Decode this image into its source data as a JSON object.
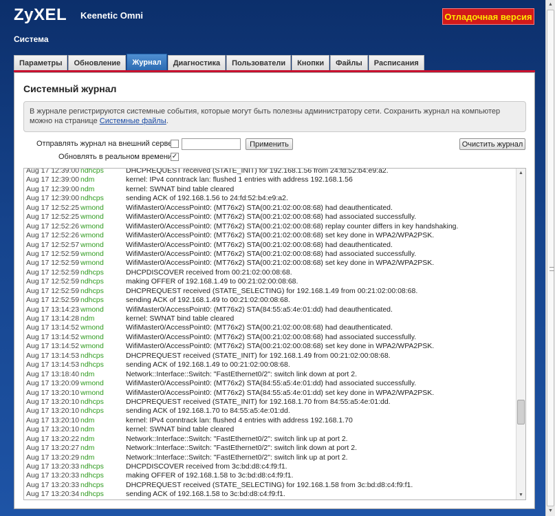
{
  "header": {
    "logo": "ZyXEL",
    "product": "Keenetic Omni",
    "debug_badge": "Отладочная версия",
    "section": "Система"
  },
  "tabs": [
    {
      "label": "Параметры",
      "active": false
    },
    {
      "label": "Обновление",
      "active": false
    },
    {
      "label": "Журнал",
      "active": true
    },
    {
      "label": "Диагностика",
      "active": false
    },
    {
      "label": "Пользователи",
      "active": false
    },
    {
      "label": "Кнопки",
      "active": false
    },
    {
      "label": "Файлы",
      "active": false
    },
    {
      "label": "Расписания",
      "active": false
    }
  ],
  "panel": {
    "title": "Системный журнал",
    "info_text": "В журнале регистрируются системные события, которые могут быть полезны администратору сети. Сохранить журнал на компьютер можно на странице ",
    "info_link": "Системные файлы",
    "info_suffix": "."
  },
  "controls": {
    "external_server_label": "Отправлять журнал на внешний сервер:",
    "external_server_checked": false,
    "server_value": "",
    "apply_button": "Применить",
    "clear_button": "Очистить журнал",
    "realtime_label": "Обновлять в реальном времени:",
    "realtime_checked": true,
    "checkmark": "✓"
  },
  "icons": {
    "scroll_up": "▲",
    "scroll_down": "▼"
  },
  "colors": {
    "service": "#2e9a1e",
    "active_tab": "#2c6bb2",
    "badge_bg": "#d21a1a",
    "badge_text": "#ffe600"
  },
  "log": [
    {
      "ts": "Aug 17 12:39:00",
      "svc": "ndhcps",
      "msg": "DHCPREQUEST received (STATE_INIT) for 192.168.1.56 from 24:fd:52:b4:e9:a2."
    },
    {
      "ts": "Aug 17 12:39:00",
      "svc": "ndm",
      "msg": "kernel: IPv4 conntrack lan: flushed 1 entries with address 192.168.1.56"
    },
    {
      "ts": "Aug 17 12:39:00",
      "svc": "ndm",
      "msg": "kernel: SWNAT bind table cleared"
    },
    {
      "ts": "Aug 17 12:39:00",
      "svc": "ndhcps",
      "msg": "sending ACK of 192.168.1.56 to 24:fd:52:b4:e9:a2."
    },
    {
      "ts": "Aug 17 12:52:25",
      "svc": "wmond",
      "msg": "WifiMaster0/AccessPoint0: (MT76x2) STA(00:21:02:00:08:68) had deauthenticated."
    },
    {
      "ts": "Aug 17 12:52:25",
      "svc": "wmond",
      "msg": "WifiMaster0/AccessPoint0: (MT76x2) STA(00:21:02:00:08:68) had associated successfully."
    },
    {
      "ts": "Aug 17 12:52:26",
      "svc": "wmond",
      "msg": "WifiMaster0/AccessPoint0: (MT76x2) STA(00:21:02:00:08:68) replay counter differs in key handshaking."
    },
    {
      "ts": "Aug 17 12:52:26",
      "svc": "wmond",
      "msg": "WifiMaster0/AccessPoint0: (MT76x2) STA(00:21:02:00:08:68) set key done in WPA2/WPA2PSK."
    },
    {
      "ts": "Aug 17 12:52:57",
      "svc": "wmond",
      "msg": "WifiMaster0/AccessPoint0: (MT76x2) STA(00:21:02:00:08:68) had deauthenticated."
    },
    {
      "ts": "Aug 17 12:52:59",
      "svc": "wmond",
      "msg": "WifiMaster0/AccessPoint0: (MT76x2) STA(00:21:02:00:08:68) had associated successfully."
    },
    {
      "ts": "Aug 17 12:52:59",
      "svc": "wmond",
      "msg": "WifiMaster0/AccessPoint0: (MT76x2) STA(00:21:02:00:08:68) set key done in WPA2/WPA2PSK."
    },
    {
      "ts": "Aug 17 12:52:59",
      "svc": "ndhcps",
      "msg": "DHCPDISCOVER received  from 00:21:02:00:08:68."
    },
    {
      "ts": "Aug 17 12:52:59",
      "svc": "ndhcps",
      "msg": "making OFFER of 192.168.1.49 to 00:21:02:00:08:68."
    },
    {
      "ts": "Aug 17 12:52:59",
      "svc": "ndhcps",
      "msg": "DHCPREQUEST received (STATE_SELECTING) for 192.168.1.49 from 00:21:02:00:08:68."
    },
    {
      "ts": "Aug 17 12:52:59",
      "svc": "ndhcps",
      "msg": "sending ACK of 192.168.1.49 to 00:21:02:00:08:68."
    },
    {
      "ts": "Aug 17 13:14:23",
      "svc": "wmond",
      "msg": "WifiMaster0/AccessPoint0: (MT76x2) STA(84:55:a5:4e:01:dd) had deauthenticated."
    },
    {
      "ts": "Aug 17 13:14:28",
      "svc": "ndm",
      "msg": "kernel: SWNAT bind table cleared"
    },
    {
      "ts": "Aug 17 13:14:52",
      "svc": "wmond",
      "msg": "WifiMaster0/AccessPoint0: (MT76x2) STA(00:21:02:00:08:68) had deauthenticated."
    },
    {
      "ts": "Aug 17 13:14:52",
      "svc": "wmond",
      "msg": "WifiMaster0/AccessPoint0: (MT76x2) STA(00:21:02:00:08:68) had associated successfully."
    },
    {
      "ts": "Aug 17 13:14:52",
      "svc": "wmond",
      "msg": "WifiMaster0/AccessPoint0: (MT76x2) STA(00:21:02:00:08:68) set key done in WPA2/WPA2PSK."
    },
    {
      "ts": "Aug 17 13:14:53",
      "svc": "ndhcps",
      "msg": "DHCPREQUEST received (STATE_INIT) for 192.168.1.49 from 00:21:02:00:08:68."
    },
    {
      "ts": "Aug 17 13:14:53",
      "svc": "ndhcps",
      "msg": "sending ACK of 192.168.1.49 to 00:21:02:00:08:68."
    },
    {
      "ts": "Aug 17 13:18:40",
      "svc": "ndm",
      "msg": "Network::Interface::Switch: \"FastEthernet0/2\": switch link down at port 2."
    },
    {
      "ts": "Aug 17 13:20:09",
      "svc": "wmond",
      "msg": "WifiMaster0/AccessPoint0: (MT76x2) STA(84:55:a5:4e:01:dd) had associated successfully."
    },
    {
      "ts": "Aug 17 13:20:10",
      "svc": "wmond",
      "msg": "WifiMaster0/AccessPoint0: (MT76x2) STA(84:55:a5:4e:01:dd) set key done in WPA2/WPA2PSK."
    },
    {
      "ts": "Aug 17 13:20:10",
      "svc": "ndhcps",
      "msg": "DHCPREQUEST received (STATE_INIT) for 192.168.1.70 from 84:55:a5:4e:01:dd."
    },
    {
      "ts": "Aug 17 13:20:10",
      "svc": "ndhcps",
      "msg": "sending ACK of 192.168.1.70 to 84:55:a5:4e:01:dd."
    },
    {
      "ts": "Aug 17 13:20:10",
      "svc": "ndm",
      "msg": "kernel: IPv4 conntrack lan: flushed 4 entries with address 192.168.1.70"
    },
    {
      "ts": "Aug 17 13:20:10",
      "svc": "ndm",
      "msg": "kernel: SWNAT bind table cleared"
    },
    {
      "ts": "Aug 17 13:20:22",
      "svc": "ndm",
      "msg": "Network::Interface::Switch: \"FastEthernet0/2\": switch link up at port 2."
    },
    {
      "ts": "Aug 17 13:20:27",
      "svc": "ndm",
      "msg": "Network::Interface::Switch: \"FastEthernet0/2\": switch link down at port 2."
    },
    {
      "ts": "Aug 17 13:20:29",
      "svc": "ndm",
      "msg": "Network::Interface::Switch: \"FastEthernet0/2\": switch link up at port 2."
    },
    {
      "ts": "Aug 17 13:20:33",
      "svc": "ndhcps",
      "msg": "DHCPDISCOVER received  from 3c:bd:d8:c4:f9:f1."
    },
    {
      "ts": "Aug 17 13:20:33",
      "svc": "ndhcps",
      "msg": "making OFFER of 192.168.1.58 to 3c:bd:d8:c4:f9:f1."
    },
    {
      "ts": "Aug 17 13:20:33",
      "svc": "ndhcps",
      "msg": "DHCPREQUEST received (STATE_SELECTING) for 192.168.1.58 from 3c:bd:d8:c4:f9:f1."
    },
    {
      "ts": "Aug 17 13:20:34",
      "svc": "ndhcps",
      "msg": "sending ACK of 192.168.1.58 to 3c:bd:d8:c4:f9:f1."
    }
  ]
}
